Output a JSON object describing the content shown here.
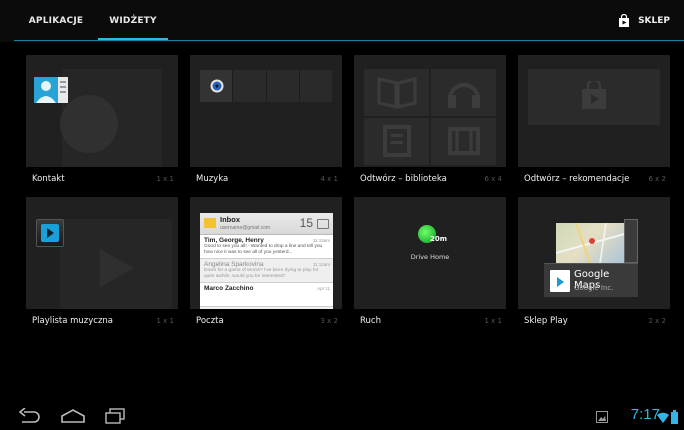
{
  "tabs": [
    {
      "label": "APLIKACJE",
      "selected": false
    },
    {
      "label": "WIDŻETY",
      "selected": true
    }
  ],
  "store_label": "SKLEP",
  "accent_color": "#33b5e5",
  "widgets": [
    {
      "label": "Kontakt",
      "size": "1 x 1"
    },
    {
      "label": "Muzyka",
      "size": "4 x 1"
    },
    {
      "label": "Odtwórz – biblioteka",
      "size": "6 x 4"
    },
    {
      "label": "Odtwórz – rekomendacje",
      "size": "6 x 2"
    },
    {
      "label": "Playlista muzyczna",
      "size": "1 x 1"
    },
    {
      "label": "Poczta",
      "size": "3 x 2"
    },
    {
      "label": "Ruch",
      "size": "1 x 1"
    },
    {
      "label": "Sklep Play",
      "size": "2 x 2"
    }
  ],
  "mail_preview": {
    "title": "Inbox",
    "account": "username@gmail.com",
    "count": "15",
    "messages": [
      {
        "from": "Tim, George, Henry",
        "snippet": "Good to see you all! - Wanted to drop a line and tell you how nice it was to see all of you yesterd...",
        "time": "11:15am"
      },
      {
        "from": "Angelina Sparkovina",
        "snippet": "Down for a game of tennis? I've been dying to play for quite awhile, would you be interested?",
        "time": "11:12am"
      },
      {
        "from": "Marco Zacchino",
        "snippet": "",
        "time": "Apr 11"
      }
    ]
  },
  "traffic_preview": {
    "minutes": "20m",
    "place": "Drive Home"
  },
  "play_preview": {
    "app": "Google Maps",
    "developer": "Google Inc."
  },
  "clock": "7:17"
}
